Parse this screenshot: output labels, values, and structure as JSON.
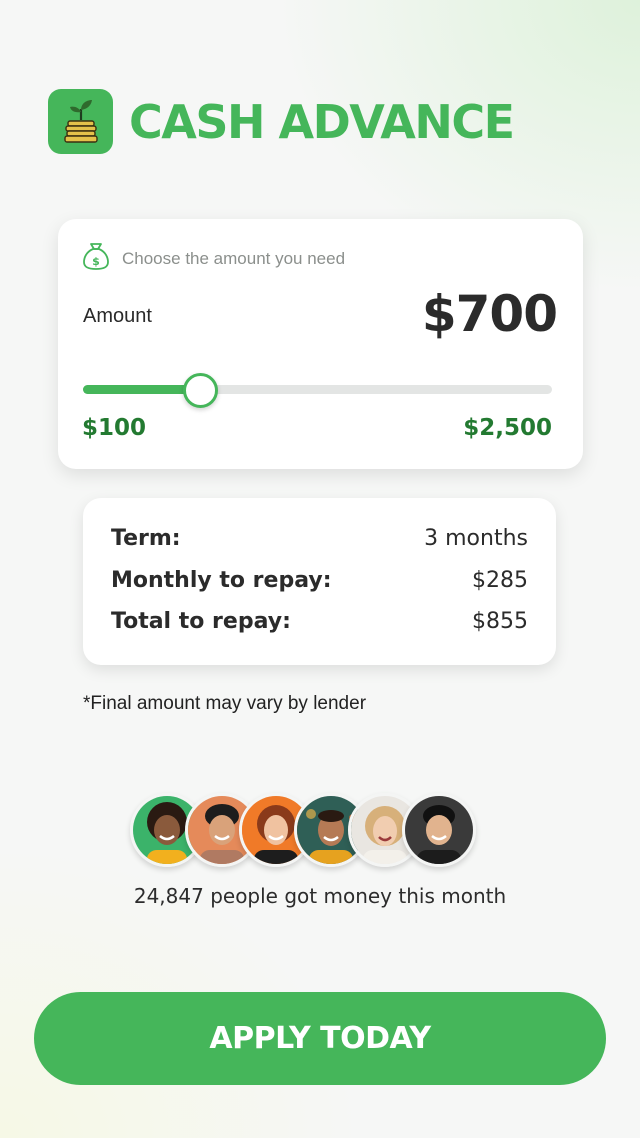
{
  "header": {
    "title": "CASH ADVANCE",
    "icon": "money-plant-icon"
  },
  "amount_card": {
    "prompt": "Choose the amount you need",
    "prompt_icon": "money-bag-icon",
    "amount_label": "Amount",
    "amount_value": "$700",
    "slider": {
      "min_label": "$100",
      "max_label": "$2,500",
      "min": 100,
      "max": 2500,
      "value": 700,
      "fill_fraction": 0.25
    }
  },
  "repay_card": {
    "rows": [
      {
        "label": "Term:",
        "value": "3 months"
      },
      {
        "label": "Monthly to repay:",
        "value": "$285"
      },
      {
        "label": "Total to repay:",
        "value": "$855"
      }
    ]
  },
  "disclaimer": "*Final amount may vary by lender",
  "social": {
    "avatar_count": 6,
    "text": "24,847 people got money this month"
  },
  "cta": {
    "label": "APPLY TODAY"
  },
  "colors": {
    "brand_green": "#45b65a",
    "dark_green": "#237a31",
    "text_dark": "#2b2b2b"
  }
}
